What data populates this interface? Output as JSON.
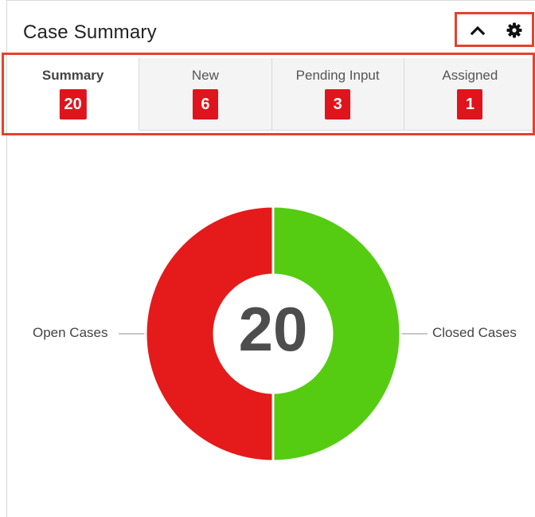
{
  "header": {
    "title": "Case Summary",
    "icons": {
      "collapse": "chevron-up-icon",
      "settings": "gear-icon"
    }
  },
  "tabs": [
    {
      "label": "Summary",
      "count": "20",
      "active": true
    },
    {
      "label": "New",
      "count": "6",
      "active": false
    },
    {
      "label": "Pending Input",
      "count": "3",
      "active": false
    },
    {
      "label": "Assigned",
      "count": "1",
      "active": false
    }
  ],
  "chart_data": {
    "type": "pie",
    "donut": true,
    "center_label": "20",
    "series": [
      {
        "name": "Open Cases",
        "value": 10,
        "color": "#e51a1a"
      },
      {
        "name": "Closed Cases",
        "value": 10,
        "color": "#55cc11"
      }
    ]
  },
  "colors": {
    "accent_red": "#e0141c",
    "highlight_border": "#e8402e",
    "tab_inactive_bg": "#f4f4f4"
  }
}
